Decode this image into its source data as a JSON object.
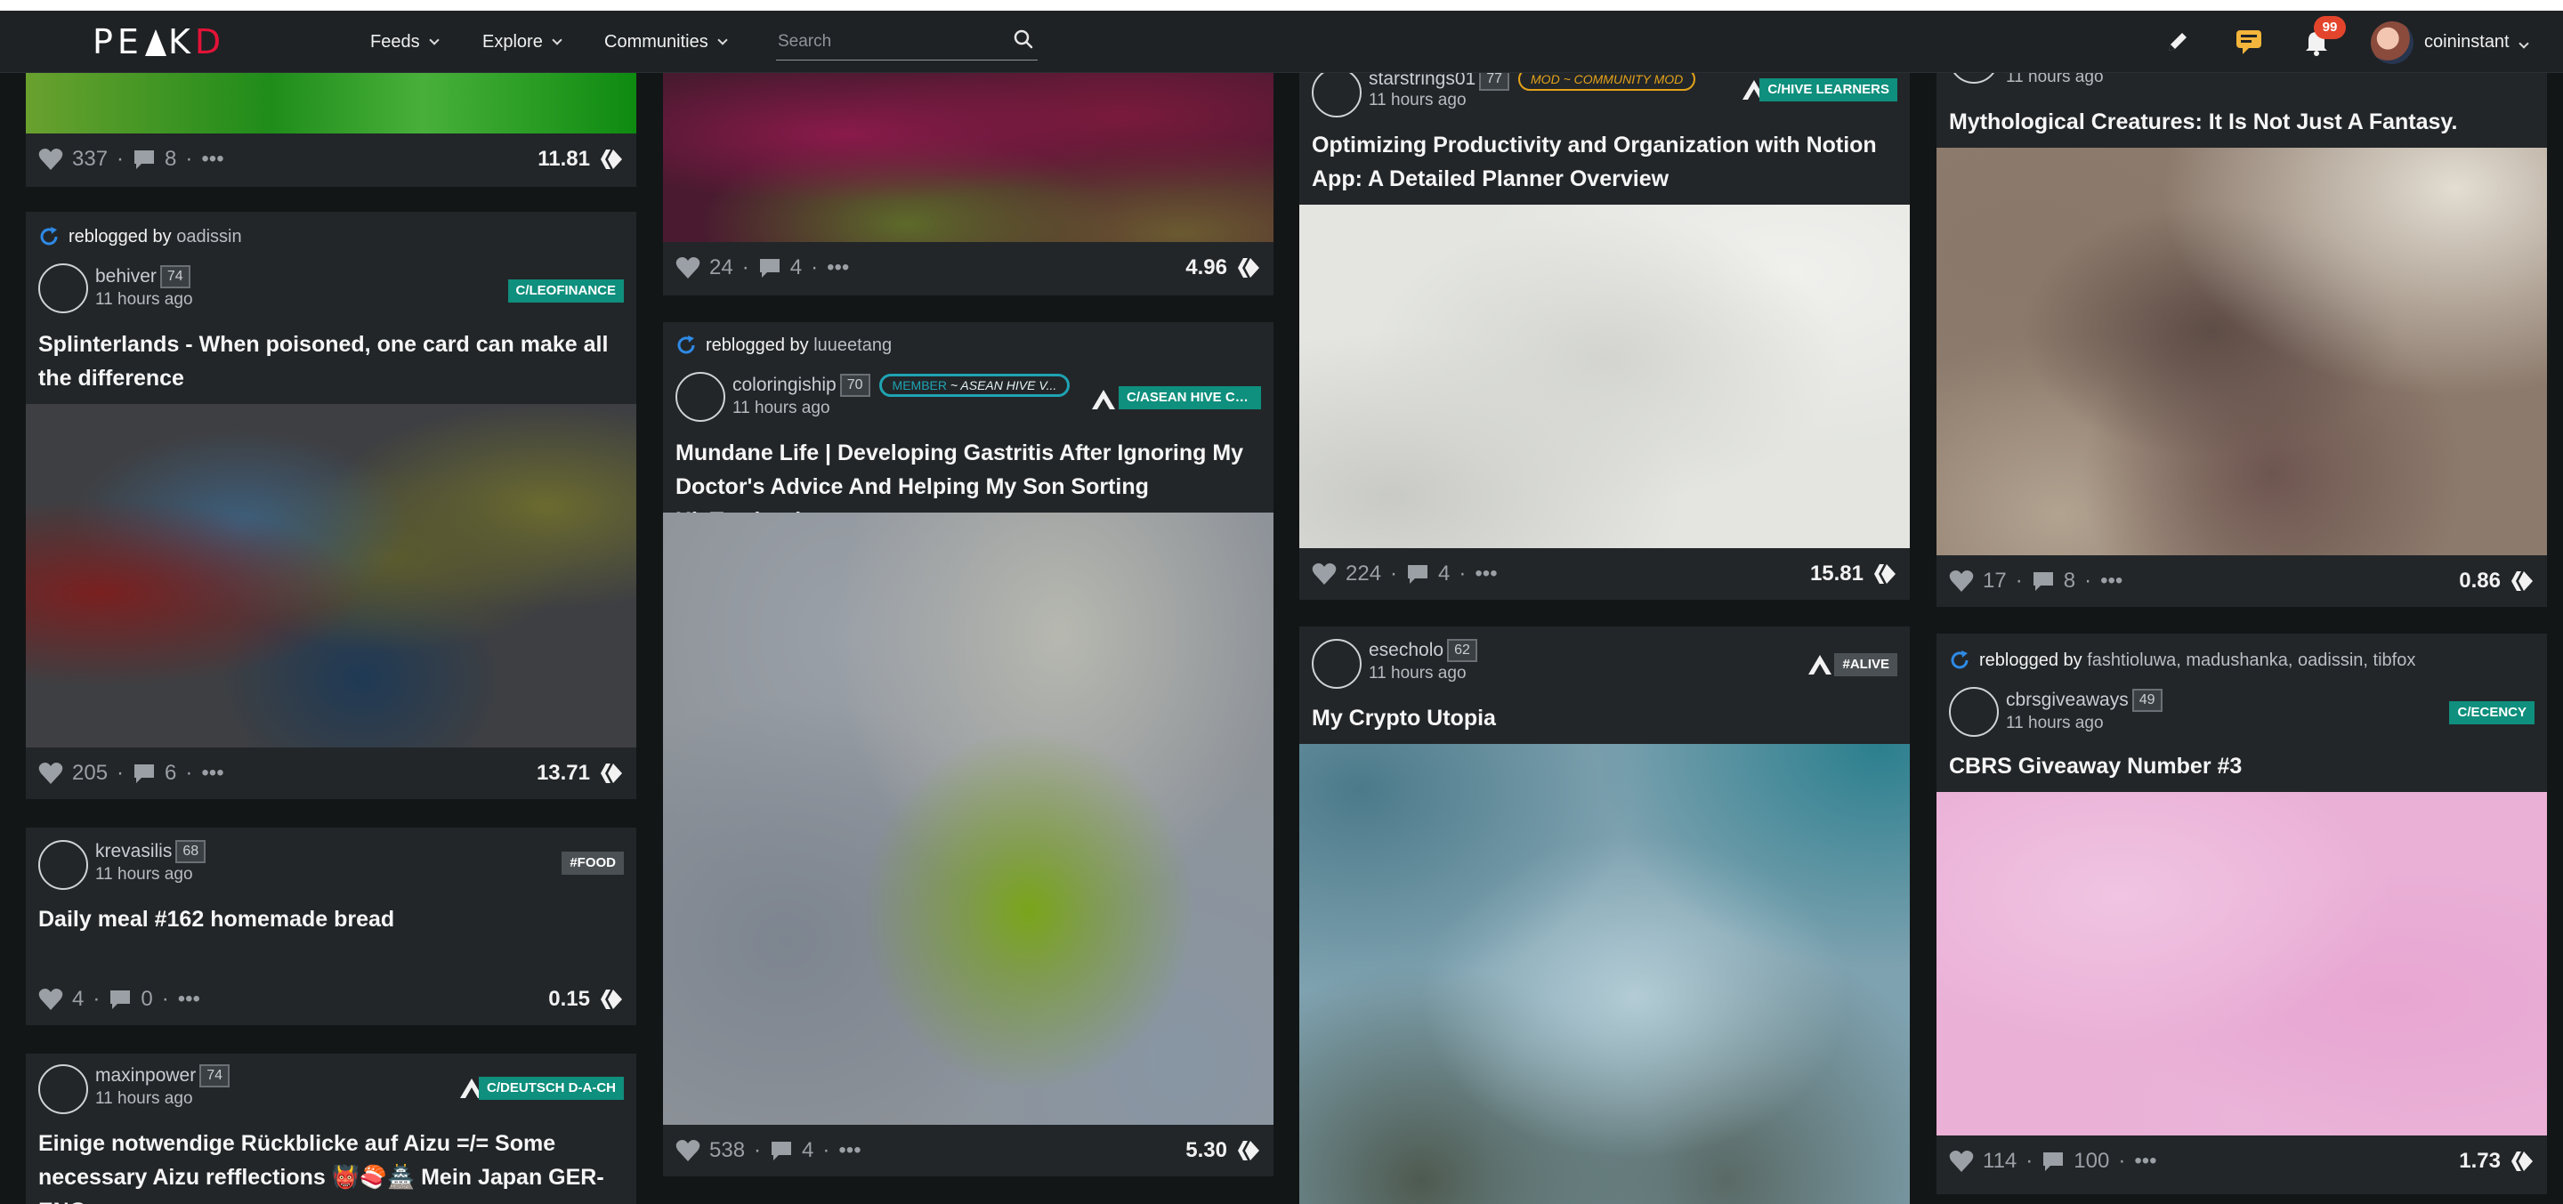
{
  "brand": {
    "logo_left": "PE",
    "logo_mid": "K",
    "logo_right": "D"
  },
  "nav": {
    "feeds": "Feeds",
    "explore": "Explore",
    "communities": "Communities"
  },
  "search": {
    "placeholder": "Search"
  },
  "user": {
    "name": "coininstant",
    "notification_count": "99"
  },
  "reblog_prefix": "reblogged by",
  "posts": {
    "c1a": {
      "likes": "337",
      "comments": "8",
      "payout": "11.81"
    },
    "c1b": {
      "reblogged_by": "oadissin",
      "author": "behiver",
      "rep": "74",
      "time": "11 hours ago",
      "tag": "C/LEOFINANCE",
      "title": "Splinterlands - When poisoned, one card can make all the difference",
      "likes": "205",
      "comments": "6",
      "payout": "13.71"
    },
    "c1c": {
      "author": "krevasilis",
      "rep": "68",
      "time": "11 hours ago",
      "tag": "#FOOD",
      "title": "Daily meal #162 homemade bread",
      "likes": "4",
      "comments": "0",
      "payout": "0.15"
    },
    "c1d": {
      "author": "maxinpower",
      "rep": "74",
      "time": "11 hours ago",
      "tag": "C/DEUTSCH D-A-CH",
      "title": "Einige notwendige Rückblicke auf Aizu =/= Some necessary Aizu refflections 👹🍣🏯 Mein Japan GER-ENG"
    },
    "c2a": {
      "likes": "24",
      "comments": "4",
      "payout": "4.96"
    },
    "c2b": {
      "reblogged_by": "luueetang",
      "author": "coloringiship",
      "rep": "70",
      "time": "11 hours ago",
      "badge_role": "MEMBER",
      "badge_community": "~ ASEAN HIVE V...",
      "tag": "C/ASEAN HIVE CO...",
      "title": "Mundane Life | Developing Gastritis After Ignoring My Doctor's Advice And Helping My Son Sorting HisTextbooks",
      "likes": "538",
      "comments": "4",
      "payout": "5.30"
    },
    "c3a": {
      "author": "starstrings01",
      "rep": "77",
      "time": "11 hours ago",
      "badge_role": "MOD",
      "badge_community": "~ COMMUNITY MOD",
      "tag": "C/HIVE LEARNERS",
      "title": "Optimizing Productivity and Organization with Notion App: A Detailed Planner Overview",
      "likes": "224",
      "comments": "4",
      "payout": "15.81"
    },
    "c3b": {
      "author": "esecholo",
      "rep": "62",
      "time": "11 hours ago",
      "tag": "#ALIVE",
      "title": "My Crypto Utopia"
    },
    "c4a": {
      "time": "11 hours ago",
      "title": "Mythological Creatures: It Is Not Just A Fantasy.",
      "likes": "17",
      "comments": "8",
      "payout": "0.86"
    },
    "c4b": {
      "reblogged_by": "fashtioluwa, madushanka, oadissin, tibfox",
      "author": "cbrsgiveaways",
      "rep": "49",
      "time": "11 hours ago",
      "tag": "C/ECENCY",
      "title": "CBRS Giveaway Number #3",
      "likes": "114",
      "comments": "100",
      "payout": "1.73"
    }
  },
  "colors": {
    "accent_teal": "#0f8f7d",
    "notification": "#e3452c",
    "mod_badge": "#e3a21a",
    "member_badge": "#1fa3b3"
  }
}
